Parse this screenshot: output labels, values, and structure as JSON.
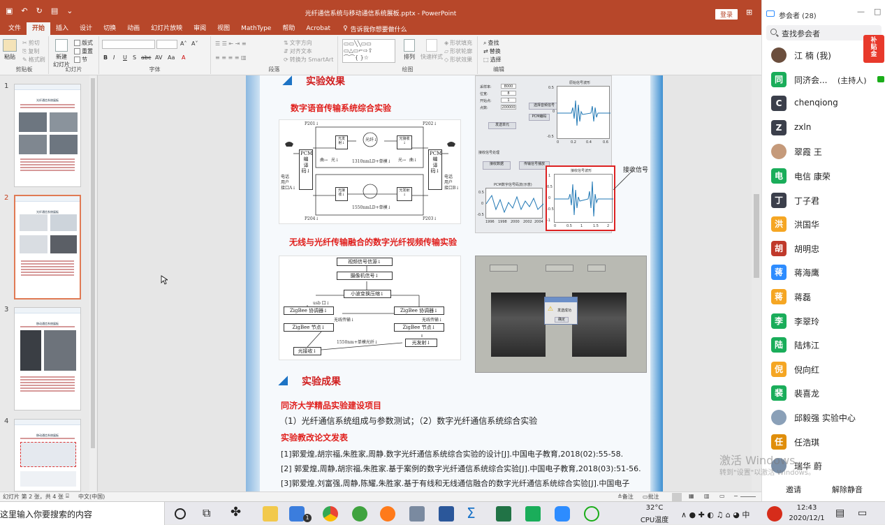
{
  "ppt": {
    "title_bar": {
      "doc_title": "光纤通信系统与移动通信系统展板.pptx - PowerPoint",
      "login_button": "登录"
    },
    "tabs": [
      "文件",
      "开始",
      "插入",
      "设计",
      "切换",
      "动画",
      "幻灯片放映",
      "审阅",
      "视图",
      "MathType",
      "帮助",
      "Acrobat"
    ],
    "active_tab": "开始",
    "tell_me": "告诉我你想要做什么",
    "ribbon": {
      "clipboard": {
        "paste": "粘贴",
        "cut": "剪切",
        "copy": "复制",
        "format_painter": "格式刷",
        "group": "剪贴板"
      },
      "slides": {
        "new_slide": "新建\n幻灯片",
        "layout": "版式",
        "reset": "重置",
        "section": "节",
        "group": "幻灯片"
      },
      "font": {
        "group": "字体",
        "bold": "B",
        "italic": "I",
        "underline": "U",
        "strike": "S",
        "abc": "abc",
        "av": "AV",
        "aa": "Aa",
        "grow": "A˄",
        "shrink": "A˅",
        "color": "A"
      },
      "paragraph": {
        "group": "段落",
        "text_direction": "文字方向",
        "align_text": "对齐文本",
        "smartart": "转换为 SmartArt"
      },
      "drawing": {
        "group": "绘图",
        "arrange": "排列",
        "quick_styles": "快速样式",
        "fill": "形状填充",
        "outline": "形状轮廓",
        "effects": "形状效果"
      },
      "editing": {
        "group": "编辑",
        "find": "查找",
        "replace": "替换",
        "select": "选择"
      }
    },
    "thumbnails": [
      {
        "num": "1",
        "title": "光纤通信系统展板"
      },
      {
        "num": "2",
        "title": "光纤通信系统展板"
      },
      {
        "num": "3",
        "title": "移动通信系统展板"
      },
      {
        "num": "4",
        "title": "移动通信系统展板"
      }
    ],
    "active_slide": "2",
    "slide": {
      "sec1_title": "实验效果",
      "sub1": "数字语音传输系统综合实验",
      "sub2": "无线与光纤传输融合的数字光纤视频传输实验",
      "sec2_title": "实验成果",
      "project_title": "同济大学精品实验建设项目",
      "project_body": "（1）光纤通信系统组成与参数测试；（2）数字光纤通信系统综合实验",
      "papers_title": "实验教改论文发表",
      "papers": [
        "[1]郭爱煌,胡宗福,朱胜家,周静.数字光纤通信系统综合实验的设计[J].中国电子教育,2018(02):55-58.",
        "[2] 郭爱煌,周静,胡宗福,朱胜家.基于案例的数字光纤通信系统综合实验[J].中国电子教育,2018(03):51-56.",
        "[3]郭爱煌,刘富强,周静,陈耀,朱胜家.基于有线和无线通信融合的数字光纤通信系统综合实验[J].中国电子"
      ],
      "diagram1": {
        "p201": "P201↓",
        "p202": "P202↓",
        "p203": "P203↓",
        "p204": "P204↓",
        "pcm_left": "PCM\n编\n译\n码↓",
        "pcm_right": "PCM\n编\n译\n码↓",
        "tx_top": "光发射↓",
        "rx_top": "光接收↓",
        "rx_bot": "光接收↓",
        "tx_bot": "光发射↓",
        "fiber": "光纤↓",
        "l1310": "1310nmLD+单模↓",
        "l1550": "1550nmLD+单模↓",
        "user_a": "电话\n用户\n接口A↓",
        "user_b": "电话\n用户\n接口B↓",
        "label_in1": "曲→",
        "label_out1": "光↓",
        "label_in2": "光→",
        "label_out2": "曲↓"
      },
      "gui": {
        "label_rate": "采样率:",
        "val_rate": "8000",
        "label_bits": "位宽:",
        "val_bits": "8",
        "label_start": "开始点:",
        "val_start": "1",
        "label_len": "点数:",
        "val_len": "200000",
        "btn_choose": "选择音频信号",
        "btn_pcm": "PCM编码",
        "btn_send": "发送单元",
        "section2": "接收信号处理",
        "btn_recv": "接收数据",
        "btn_play": "传输信号播放",
        "plot1_title": "原始信号波形",
        "plot2_title": "PCM数字信号码流(示意)",
        "plot3_title": "接收信号波形",
        "recv_label": "接收信号",
        "p1_x": [
          "0",
          "0.2",
          "0.4",
          "0.6"
        ],
        "p1_y": [
          "0.5",
          "0",
          "-0.5"
        ],
        "p2_x": [
          "1996",
          "1998",
          "2000",
          "2002",
          "2004"
        ],
        "p2_y": [
          "0.5",
          "0",
          "-0.5"
        ],
        "p3_x": [
          "0",
          "0.5",
          "1",
          "1.5",
          "2"
        ],
        "p3_y": [
          "1",
          "0.5",
          "0",
          "-0.5",
          "-1"
        ]
      },
      "diagram2": {
        "video": "视频信号信源↓",
        "camera": "摄像机信号↓",
        "compress": "小波变换压缩↓",
        "usb": "usb 口↓",
        "zb_coord_l": "ZigBee 协调器↓",
        "wireless_l": "无线传输↓",
        "zb_node_l": "ZigBee 节点↓",
        "zb_coord_r": "ZigBee 协调器↓",
        "wireless_r": "无线传输↓",
        "zb_node_r": "ZigBee 节点↓",
        "fiber_label": "1550nm+单模光纤↓",
        "rx": "光接收↓",
        "tx": "光发射↓"
      },
      "photo_dialog": {
        "title": "",
        "warn_text": "发送成功",
        "ok": "确定"
      }
    },
    "status": {
      "slide_info": "幻灯片 第 2 张，共 4 张",
      "lang": "中文(中国)",
      "notes": "备注",
      "comments": "批注"
    }
  },
  "zoom": {
    "panel_title": "参会者 (28)",
    "search_placeholder": "查找参会者",
    "sticker": "补\n贴\n金",
    "participants": [
      {
        "initial": "",
        "name": "江 楠 (我)",
        "color": "#6b4e3d",
        "photo": true
      },
      {
        "initial": "同",
        "name": "同济会...",
        "host": "(主持人)",
        "color": "#1aad5a"
      },
      {
        "initial": "C",
        "name": "chenqiong",
        "color": "#3b3f4b"
      },
      {
        "initial": "Z",
        "name": "zxln",
        "color": "#3b3f4b"
      },
      {
        "initial": "",
        "name": "翠霞 王",
        "color": "#c59a7a",
        "photo": true
      },
      {
        "initial": "电",
        "name": "电信 康荣",
        "color": "#1aad5a"
      },
      {
        "initial": "丁",
        "name": "丁子君",
        "color": "#3b3f4b"
      },
      {
        "initial": "洪",
        "name": "洪国华",
        "color": "#f5a623"
      },
      {
        "initial": "胡",
        "name": "胡明忠",
        "color": "#c0392b"
      },
      {
        "initial": "蒋",
        "name": "蒋海鹰",
        "color": "#2d8cff"
      },
      {
        "initial": "蒋",
        "name": "蒋磊",
        "color": "#f5a623"
      },
      {
        "initial": "李",
        "name": "李翠玲",
        "color": "#1aad5a"
      },
      {
        "initial": "陆",
        "name": "陆炜江",
        "color": "#1aad5a"
      },
      {
        "initial": "倪",
        "name": "倪向红",
        "color": "#f5a623"
      },
      {
        "initial": "裴",
        "name": "裴喜龙",
        "color": "#1aad5a"
      },
      {
        "initial": "",
        "name": "邱毅强 实验中心",
        "color": "#8aa0b8",
        "photo": true
      },
      {
        "initial": "任",
        "name": "任浩琪",
        "color": "#e08e0b"
      },
      {
        "initial": "",
        "name": "瑞华 蔚",
        "color": "#7a8fa8",
        "photo": true
      }
    ],
    "invite": "邀请",
    "unmute_all": "解除静音"
  },
  "watermark": {
    "line1": "激活 Windows",
    "line2": "转到\"设置\"以激活 Windows。"
  },
  "taskbar": {
    "search_text": "这里输入你要搜索的内容",
    "weather_temp": "32°C",
    "weather_label": "CPU温度",
    "time": "12:43",
    "date": "2020/12/1",
    "badge": "1"
  }
}
